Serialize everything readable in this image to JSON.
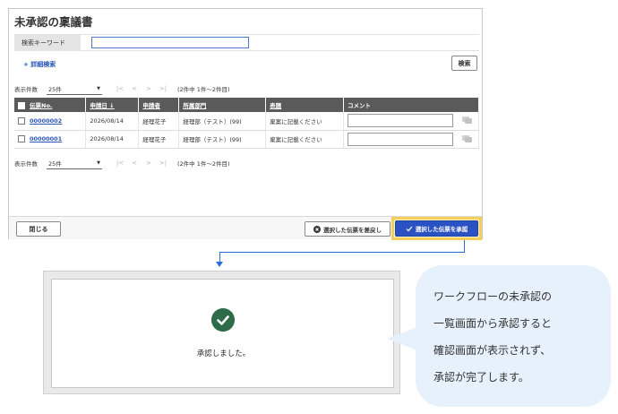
{
  "window": {
    "title": "未承認の稟議書"
  },
  "search": {
    "label": "検索キーワード",
    "value": "",
    "advanced_link": "+ 詳細検索",
    "button": "検索"
  },
  "pager": {
    "label": "表示件数",
    "page_size": "25件",
    "first": "|<",
    "prev": "<",
    "next": ">",
    "last": ">|",
    "info": "(2件中 1件～2件目)"
  },
  "table": {
    "headers": [
      "伝票No.",
      "申請日 ↓",
      "申請者",
      "所属部門",
      "表題",
      "コメント"
    ],
    "rows": [
      {
        "slip_no": "00000002",
        "date": "2026/08/14",
        "applicant": "経理花子",
        "department": "経理部（テスト）(99)",
        "subject": "稟案に記載ください"
      },
      {
        "slip_no": "00000001",
        "date": "2026/08/14",
        "applicant": "経理花子",
        "department": "経理部（テスト）(99)",
        "subject": "稟案に記載ください"
      }
    ]
  },
  "footer": {
    "close": "閉じる",
    "reject": "選択した伝票を差戻し",
    "approve": "選択した伝票を承認"
  },
  "dialog": {
    "message": "承認しました。"
  },
  "bubble": {
    "text": "ワークフローの未承認の\n一覧画面から承認すると\n確認画面が表示されず、\n承認が完了します。"
  },
  "colors": {
    "accent": "#2b52c2",
    "highlight": "#f3cf59",
    "success": "#2e6b48",
    "bubble": "#e6f1fb"
  }
}
